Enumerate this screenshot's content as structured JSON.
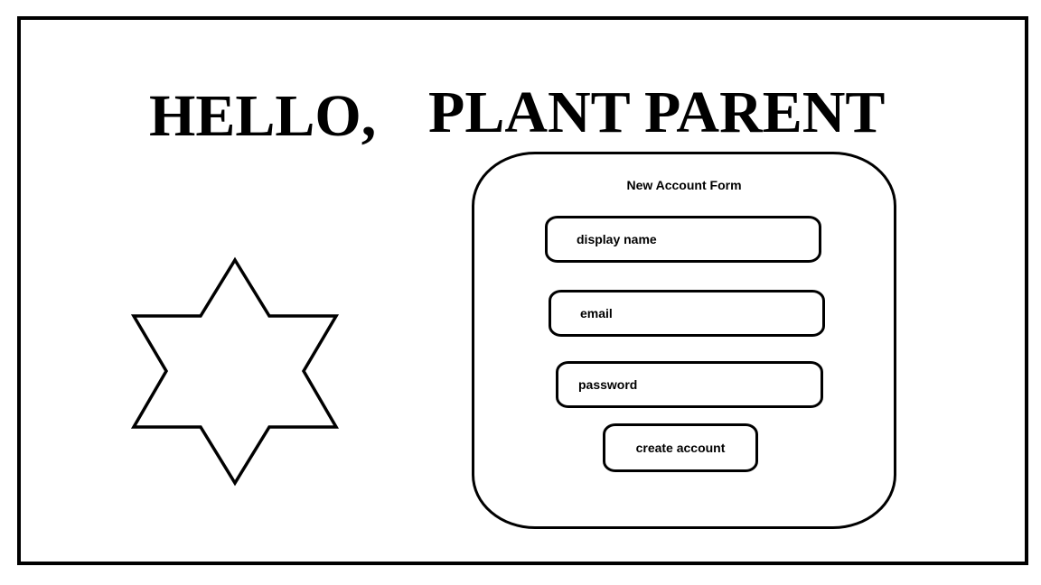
{
  "header": {
    "greeting": "HELLO,",
    "subtitle": "PLANT PARENT"
  },
  "logo": {
    "icon": "six-pointed-star-icon"
  },
  "form": {
    "title": "New Account Form",
    "display_name_placeholder": "display name",
    "email_placeholder": "email",
    "password_placeholder": "password",
    "submit_label": "create account"
  }
}
